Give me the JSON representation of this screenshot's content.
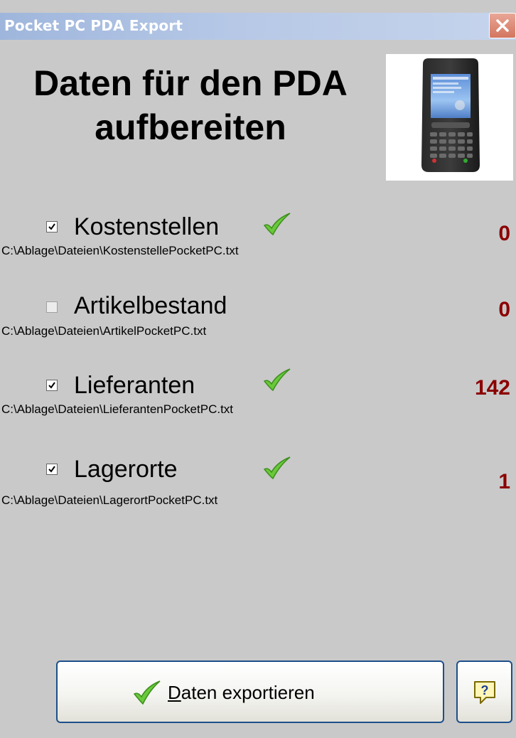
{
  "window": {
    "title": "Pocket PC PDA Export"
  },
  "heading": {
    "line1": "Daten für den PDA",
    "line2": "aufbereiten"
  },
  "items": [
    {
      "label": "Kostenstellen",
      "path": "C:\\Ablage\\Dateien\\KostenstellePocketPC.txt",
      "count": "0",
      "checked": true,
      "done": true
    },
    {
      "label": "Artikelbestand",
      "path": "C:\\Ablage\\Dateien\\ArtikelPocketPC.txt",
      "count": "0",
      "checked": false,
      "done": false
    },
    {
      "label": "Lieferanten",
      "path": "C:\\Ablage\\Dateien\\LieferantenPocketPC.txt",
      "count": "142",
      "checked": true,
      "done": true
    },
    {
      "label": "Lagerorte",
      "path": "C:\\Ablage\\Dateien\\LagerortPocketPC.txt",
      "count": "1",
      "checked": true,
      "done": true
    }
  ],
  "buttons": {
    "export_label_mnemonic": "D",
    "export_label_rest": "aten exportieren",
    "help_icon": "help-icon"
  },
  "icons": {
    "close": "close-icon",
    "ok": "checkmark-icon",
    "device": "pda-device-icon"
  },
  "colors": {
    "background": "#c9c9c9",
    "count": "#8b0000",
    "checkmark": "#5cbf2a",
    "button_border": "#1c4f8a"
  }
}
